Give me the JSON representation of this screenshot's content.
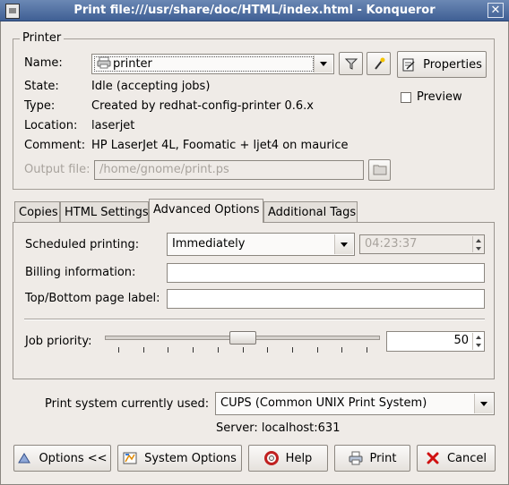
{
  "window": {
    "title": "Print file:///usr/share/doc/HTML/index.html - Konqueror",
    "close_glyph": "✕"
  },
  "printer_group": {
    "legend": "Printer",
    "name_label": "Name:",
    "name_label_accel": "N",
    "name_value": "printer",
    "properties_button": "Properties",
    "preview_label": "Preview",
    "preview_checked": false,
    "state_label": "State:",
    "state_value": "Idle (accepting jobs)",
    "type_label": "Type:",
    "type_value": "Created by redhat-config-printer 0.6.x",
    "location_label": "Location:",
    "location_value": "laserjet",
    "comment_label": "Comment:",
    "comment_value": "HP LaserJet 4L, Foomatic + ljet4 on maurice",
    "output_label": "Output file:",
    "output_value": "/home/gnome/print.ps"
  },
  "tabs": [
    {
      "label": "Copies",
      "active": false
    },
    {
      "label": "HTML Settings",
      "active": false
    },
    {
      "label": "Advanced Options",
      "active": true
    },
    {
      "label": "Additional Tags",
      "active": false
    }
  ],
  "advanced": {
    "scheduled_label": "Scheduled printing:",
    "scheduled_value": "Immediately",
    "scheduled_time": "04:23:37",
    "billing_label": "Billing information:",
    "billing_value": "",
    "topbottom_label": "Top/Bottom page label:",
    "topbottom_value": "",
    "priority_label": "Job priority:",
    "priority_value": "50",
    "priority_fraction": 0.5
  },
  "print_system": {
    "label": "Print system currently used:",
    "value": "CUPS (Common UNIX Print System)",
    "server": "Server: localhost:631"
  },
  "buttons": {
    "options": "Options <<",
    "system_options": "System Options",
    "help": "Help",
    "print": "Print",
    "cancel": "Cancel"
  },
  "colors": {
    "titlebar": "#4f6fa3",
    "background": "#efebe7",
    "cancel_icon": "#d01010"
  }
}
